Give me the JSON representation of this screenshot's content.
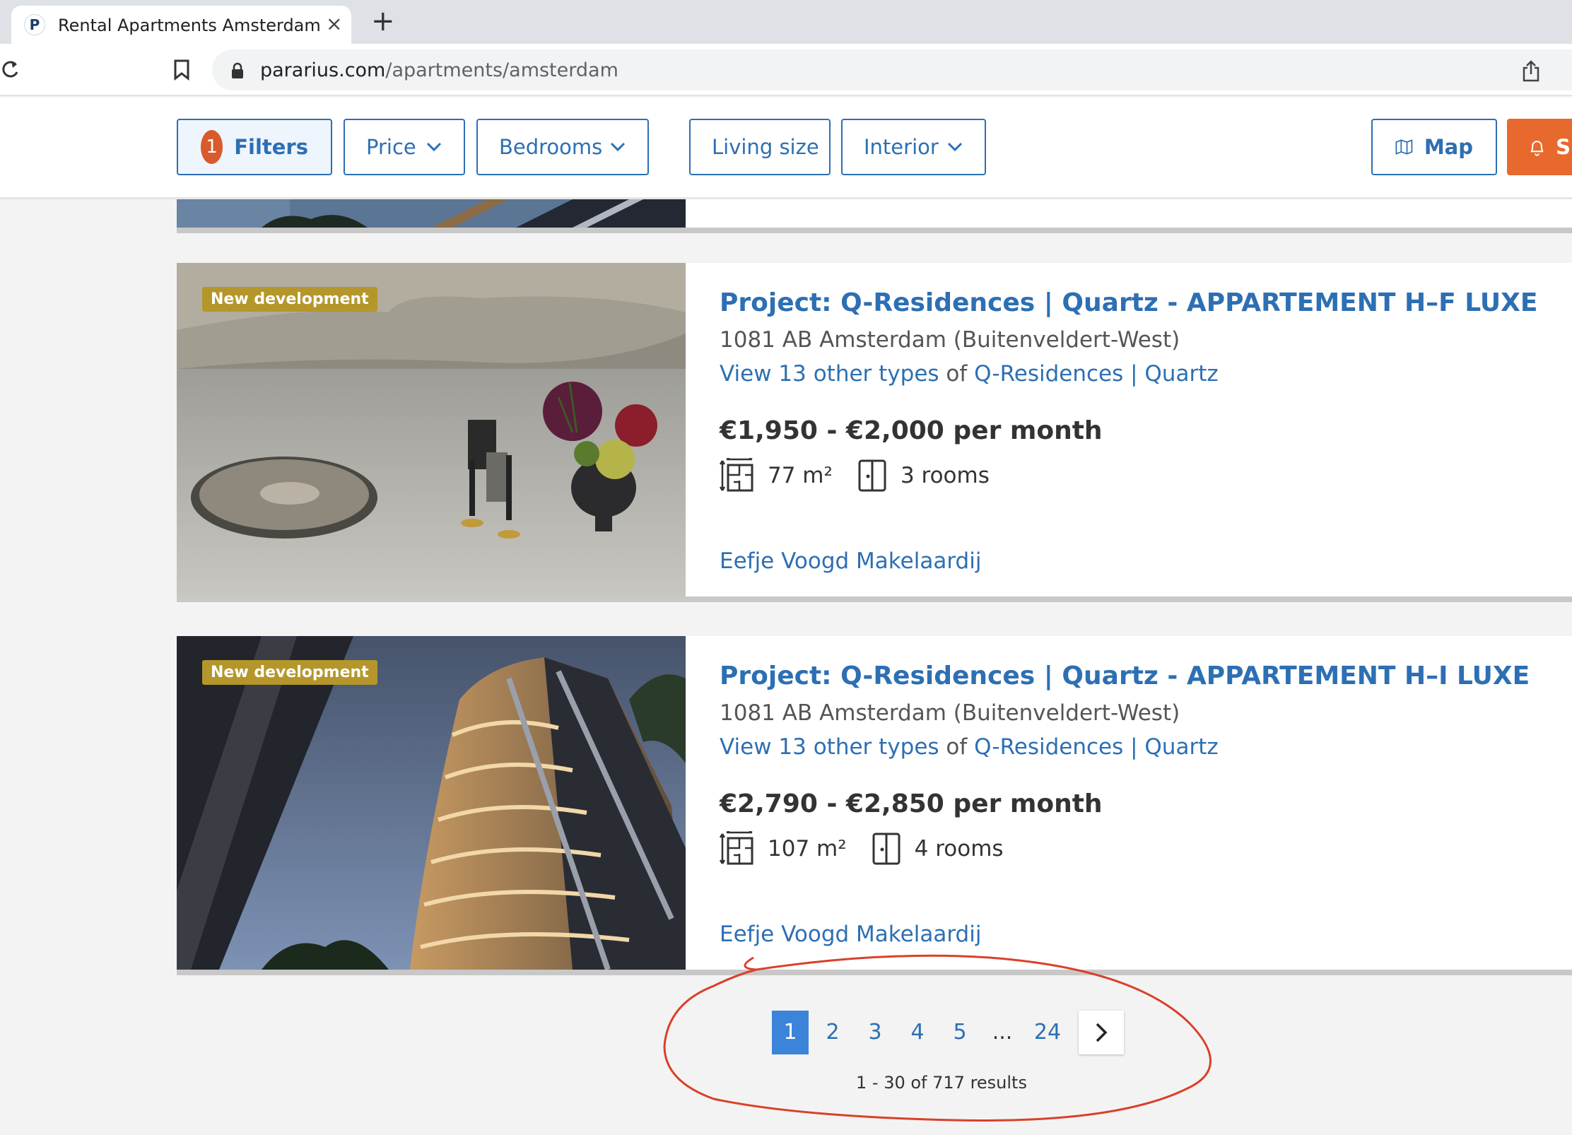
{
  "browser": {
    "tab_title": "Rental Apartments Amsterdam",
    "tab_close": "×",
    "new_tab": "+",
    "favicon": "P",
    "url_host": "pararius.com",
    "url_path": "/apartments/amsterdam"
  },
  "filters": {
    "count": "1",
    "filters_label": "Filters",
    "price_label": "Price",
    "bedrooms_label": "Bedrooms",
    "living_size_label": "Living size",
    "interior_label": "Interior",
    "map_label": "Map",
    "save_label": "S"
  },
  "listings": [
    {
      "tag": "New development",
      "title": "Project: Q-Residences | Quartz - APPARTEMENT H–F LUXE",
      "address": "1081 AB Amsterdam (Buitenveldert-West)",
      "types_link": "View 13 other types",
      "types_of": " of ",
      "types_project": "Q-Residences | Quartz",
      "price": "€1,950 - €2,000 per month",
      "size": "77 m²",
      "rooms": "3 rooms",
      "agent": "Eefje Voogd Makelaardij"
    },
    {
      "tag": "New development",
      "title": "Project: Q-Residences | Quartz - APPARTEMENT H–I LUXE",
      "address": "1081 AB Amsterdam (Buitenveldert-West)",
      "types_link": "View 13 other types",
      "types_of": " of ",
      "types_project": "Q-Residences | Quartz",
      "price": "€2,790 - €2,850 per month",
      "size": "107 m²",
      "rooms": "4 rooms",
      "agent": "Eefje Voogd Makelaardij"
    }
  ],
  "pagination": {
    "pages": [
      "1",
      "2",
      "3",
      "4",
      "5"
    ],
    "ellipsis": "...",
    "last_page": "24",
    "current": "1",
    "results": "1 - 30 of 717 results"
  },
  "colors": {
    "link": "#2d6fb3",
    "accent": "#e8692e",
    "tag": "#b5962a",
    "annotation": "#d9402a"
  }
}
